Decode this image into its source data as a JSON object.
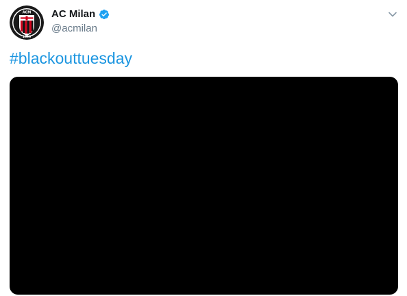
{
  "tweet": {
    "display_name": "AC Milan",
    "handle": "@acmilan",
    "text": "#blackouttuesday",
    "verified": true,
    "icons": {
      "avatar": "ac-milan-crest-icon",
      "verified": "verified-badge-icon",
      "menu": "chevron-down-icon"
    },
    "avatar_logo": {
      "top_text": "ACM",
      "year": "1899"
    },
    "colors": {
      "link": "#1b95e0",
      "verified": "#1da1f2",
      "name": "#14171a",
      "handle": "#657786",
      "media_background": "#000000",
      "crest_red": "#d0021b"
    }
  }
}
